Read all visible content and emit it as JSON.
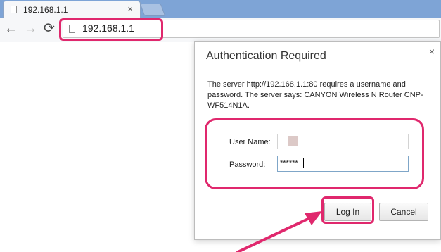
{
  "browser": {
    "tab": {
      "title": "192.168.1.1",
      "close": "×"
    },
    "nav": {
      "back": "←",
      "forward": "→",
      "reload": "⟳"
    },
    "address": {
      "url": "192.168.1.1"
    }
  },
  "dialog": {
    "title": "Authentication Required",
    "close": "×",
    "message": "The server http://192.168.1.1:80 requires a username and password. The server says: CANYON Wireless N Router CNP-WF514N1A.",
    "username_label": "User Name:",
    "username_value": "",
    "password_label": "Password:",
    "password_value": "******",
    "login_label": "Log In",
    "cancel_label": "Cancel"
  },
  "colors": {
    "highlight": "#e0286d",
    "titlebar": "#7ea4d6"
  },
  "icons": [
    "page-icon",
    "back-arrow-icon",
    "forward-arrow-icon",
    "reload-icon",
    "close-icon",
    "pointer-arrow-icon"
  ]
}
